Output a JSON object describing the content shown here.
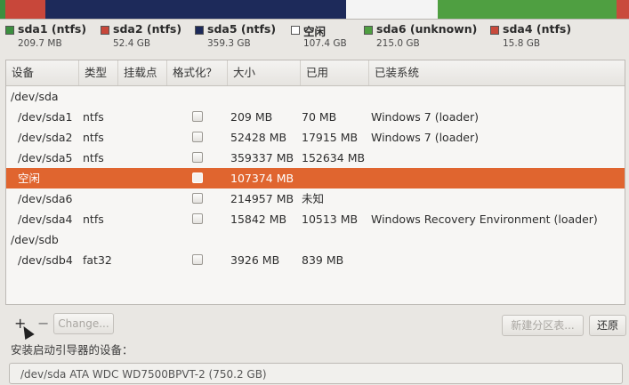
{
  "colors": {
    "ntfs_green": "#3b8f3f",
    "sda2_red": "#c8473a",
    "sda5_navy": "#1d2a5a",
    "free_white": "#ffffff",
    "sda6_green": "#4f9f41",
    "sda4_red": "#c94a3c",
    "selection_orange": "#e0652f"
  },
  "legend": [
    {
      "name": "sda1 (ntfs)",
      "size": "209.7 MB",
      "color": "#3b8f3f"
    },
    {
      "name": "sda2 (ntfs)",
      "size": "52.4 GB",
      "color": "#c8473a"
    },
    {
      "name": "sda5 (ntfs)",
      "size": "359.3 GB",
      "color": "#1d2a5a"
    },
    {
      "name": "空闲",
      "size": "107.4 GB",
      "color": "#ffffff"
    },
    {
      "name": "sda6 (unknown)",
      "size": "215.0 GB",
      "color": "#4f9f41"
    },
    {
      "name": "sda4 (ntfs)",
      "size": "15.8 GB",
      "color": "#c94a3c"
    }
  ],
  "table": {
    "headers": [
      "设备",
      "类型",
      "挂载点",
      "格式化？",
      "大小",
      "已用",
      "已装系统"
    ],
    "rows": [
      {
        "device": "/dev/sda",
        "type": "",
        "mount": "",
        "format": false,
        "size": "",
        "used": "",
        "system": "",
        "group": true
      },
      {
        "device": "/dev/sda1",
        "type": "ntfs",
        "mount": "",
        "format": false,
        "size": "209 MB",
        "used": "70 MB",
        "system": "Windows 7 (loader)"
      },
      {
        "device": "/dev/sda2",
        "type": "ntfs",
        "mount": "",
        "format": false,
        "size": "52428 MB",
        "used": "17915 MB",
        "system": "Windows 7 (loader)"
      },
      {
        "device": "/dev/sda5",
        "type": "ntfs",
        "mount": "",
        "format": false,
        "size": "359337 MB",
        "used": "152634 MB",
        "system": ""
      },
      {
        "device": "空闲",
        "type": "",
        "mount": "",
        "format": false,
        "size": "107374 MB",
        "used": "",
        "system": "",
        "selected": true
      },
      {
        "device": "/dev/sda6",
        "type": "",
        "mount": "",
        "format": false,
        "size": "214957 MB",
        "used": "未知",
        "system": ""
      },
      {
        "device": "/dev/sda4",
        "type": "ntfs",
        "mount": "",
        "format": false,
        "size": "15842 MB",
        "used": "10513 MB",
        "system": "Windows Recovery Environment (loader)"
      },
      {
        "device": "/dev/sdb",
        "type": "",
        "mount": "",
        "format": false,
        "size": "",
        "used": "",
        "system": "",
        "group": true
      },
      {
        "device": "/dev/sdb4",
        "type": "fat32",
        "mount": "",
        "format": false,
        "size": "3926 MB",
        "used": "839 MB",
        "system": ""
      }
    ]
  },
  "toolbar": {
    "add_label": "+",
    "remove_label": "−",
    "change_label": "Change...",
    "new_table_label": "新建分区表...",
    "revert_label": "还原"
  },
  "bootloader": {
    "label": "安装启动引导器的设备：",
    "value": "/dev/sda   ATA WDC WD7500BPVT-2 (750.2 GB)"
  }
}
